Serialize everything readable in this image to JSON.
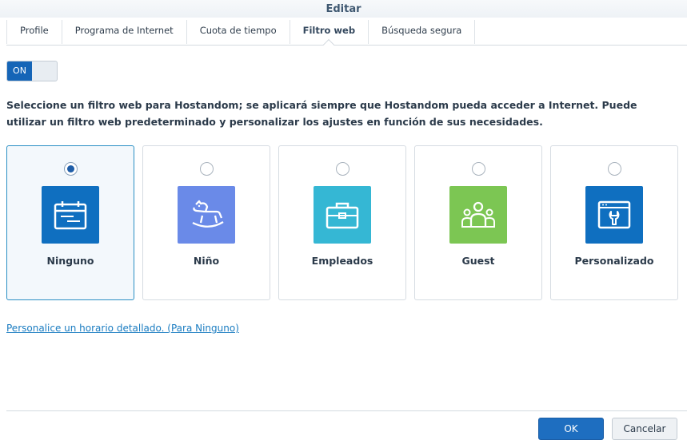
{
  "window": {
    "title": "Editar"
  },
  "tabs": [
    {
      "label": "Profile"
    },
    {
      "label": "Programa de Internet"
    },
    {
      "label": "Cuota de tiempo"
    },
    {
      "label": "Filtro web",
      "active": true
    },
    {
      "label": "Búsqueda segura"
    }
  ],
  "toggle": {
    "state_label": "ON",
    "on": true
  },
  "description": "Seleccione un filtro web para Hostandom; se aplicará siempre que Hostandom pueda acceder a Internet. Puede utilizar un filtro web predeterminado y personalizar los ajustes en función de sus necesidades.",
  "filters": [
    {
      "label": "Ninguno",
      "selected": true,
      "icon": "calendar-list-icon",
      "color": "#0f6fc0"
    },
    {
      "label": "Niño",
      "selected": false,
      "icon": "rocking-horse-icon",
      "color": "#6a8ae8"
    },
    {
      "label": "Empleados",
      "selected": false,
      "icon": "briefcase-icon",
      "color": "#35b7d4"
    },
    {
      "label": "Guest",
      "selected": false,
      "icon": "group-users-icon",
      "color": "#7cc653"
    },
    {
      "label": "Personalizado",
      "selected": false,
      "icon": "browser-wrench-icon",
      "color": "#0f6fc0"
    }
  ],
  "schedule_link": "Personalice un horario detallado. (Para Ninguno)",
  "buttons": {
    "ok": "OK",
    "cancel": "Cancelar"
  }
}
